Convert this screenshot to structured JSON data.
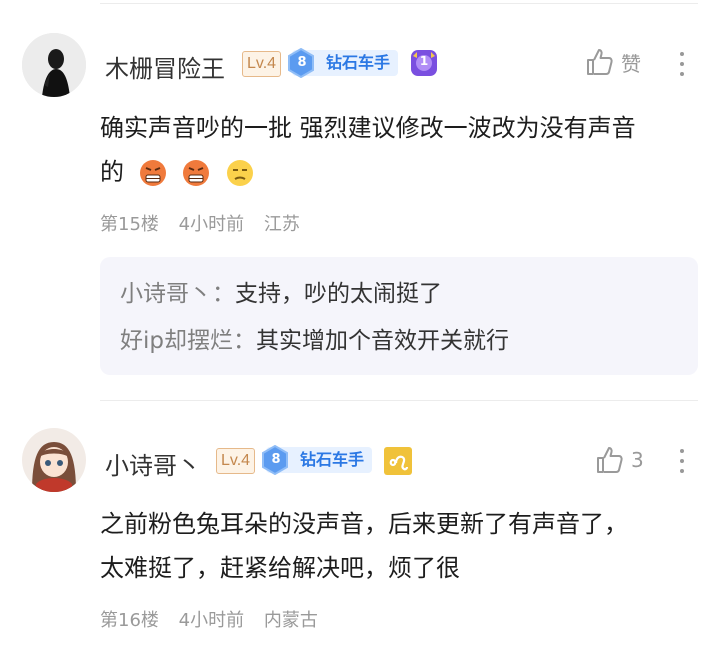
{
  "comments": [
    {
      "username": "木栅冒险王",
      "level": "Lv.4",
      "rank_number": "8",
      "rank_label": "钻石车手",
      "extra_badge_number": "1",
      "like_label": "赞",
      "text_line1": "确实声音吵的一批 强烈建议修改一波改为没有声音",
      "text_line2": "的",
      "emoji_names": [
        "angry-face-icon",
        "angry-face-icon",
        "unamused-face-icon"
      ],
      "floor": "第15楼",
      "time": "4小时前",
      "location": "江苏",
      "replies": [
        {
          "name": "小诗哥丶",
          "sep": "：",
          "text": "支持，吵的太闹挺了"
        },
        {
          "name": "好ip却摆烂",
          "sep": "：",
          "text": "其实增加个音效开关就行"
        }
      ]
    },
    {
      "username": "小诗哥丶",
      "level": "Lv.4",
      "rank_number": "8",
      "rank_label": "钻石车手",
      "like_count": "3",
      "text_line1": "之前粉色兔耳朵的没声音，后来更新了有声音了，",
      "text_line2": "太难挺了，赶紧给解决吧，烦了很",
      "floor": "第16楼",
      "time": "4小时前",
      "location": "内蒙古"
    }
  ],
  "colors": {
    "level_badge": "#c4884e",
    "rank_badge": "#2b78e4",
    "meta_text": "#9a9a9a",
    "reply_bg": "#f5f5fb"
  }
}
